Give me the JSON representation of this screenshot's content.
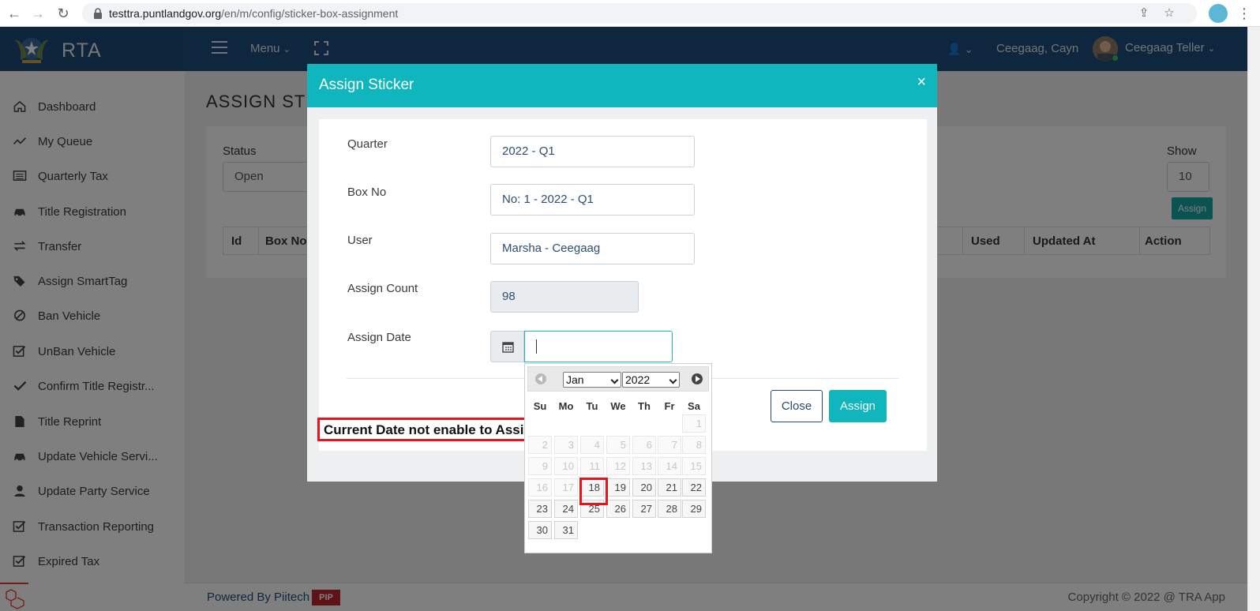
{
  "browser": {
    "url_host": "testtra.puntlandgov.org",
    "url_path": "/en/m/config/sticker-box-assignment"
  },
  "header": {
    "app_name": "RTA",
    "menu_label": "Menu",
    "user_location": "Ceegaag, Cayn",
    "user_name": "Ceegaag Teller"
  },
  "sidebar": {
    "items": [
      {
        "label": "Dashboard",
        "icon": "home-icon"
      },
      {
        "label": "My Queue",
        "icon": "trend-icon"
      },
      {
        "label": "Quarterly Tax",
        "icon": "list-icon"
      },
      {
        "label": "Title Registration",
        "icon": "car-icon"
      },
      {
        "label": "Transfer",
        "icon": "exchange-icon"
      },
      {
        "label": "Assign SmartTag",
        "icon": "tags-icon"
      },
      {
        "label": "Ban Vehicle",
        "icon": "ban-icon"
      },
      {
        "label": "UnBan Vehicle",
        "icon": "check-square-icon"
      },
      {
        "label": "Confirm Title Registr...",
        "icon": "check-icon"
      },
      {
        "label": "Title Reprint",
        "icon": "file-icon"
      },
      {
        "label": "Update Vehicle Servi...",
        "icon": "car-icon"
      },
      {
        "label": "Update Party Service",
        "icon": "user-icon"
      },
      {
        "label": "Transaction Reporting",
        "icon": "check-square-icon"
      },
      {
        "label": "Expired Tax",
        "icon": "check-square-icon"
      }
    ]
  },
  "page": {
    "title": "ASSIGN STI",
    "status_label": "Status",
    "status_value": "Open",
    "show_label": "Show",
    "show_value": "10",
    "assign_button": "Assign",
    "columns": [
      "Id",
      "Box No",
      "Used",
      "Updated At",
      "Action"
    ]
  },
  "modal": {
    "title": "Assign Sticker",
    "close_glyph": "×",
    "fields": {
      "quarter_label": "Quarter",
      "quarter_value": "2022 - Q1",
      "box_label": "Box No",
      "box_value": "No: 1 - 2022 - Q1",
      "user_label": "User",
      "user_value": "Marsha - Ceegaag",
      "count_label": "Assign Count",
      "count_value": "98",
      "date_label": "Assign Date"
    },
    "close_button": "Close",
    "assign_button": "Assign"
  },
  "annotation": {
    "text": "Current Date not enable to Assign",
    "color": "#e3161d"
  },
  "datepicker": {
    "month": "Jan",
    "year": "2022",
    "weekdays": [
      "Su",
      "Mo",
      "Tu",
      "We",
      "Th",
      "Fr",
      "Sa"
    ],
    "weeks": [
      [
        "",
        "",
        "",
        "",
        "",
        "",
        "1"
      ],
      [
        "2",
        "3",
        "4",
        "5",
        "6",
        "7",
        "8"
      ],
      [
        "9",
        "10",
        "11",
        "12",
        "13",
        "14",
        "15"
      ],
      [
        "16",
        "17",
        "18",
        "19",
        "20",
        "21",
        "22"
      ],
      [
        "23",
        "24",
        "25",
        "26",
        "27",
        "28",
        "29"
      ],
      [
        "30",
        "31",
        "",
        "",
        "",
        "",
        ""
      ]
    ],
    "first_enabled_day": 18,
    "highlighted_day": "18"
  },
  "footer": {
    "powered_by": "Powered By Piitech",
    "badge": "PIP",
    "copyright": "Copyright © 2022 @ TRA App"
  },
  "colors": {
    "header": "#1e4f7d",
    "accent": "#0fb6bd"
  }
}
